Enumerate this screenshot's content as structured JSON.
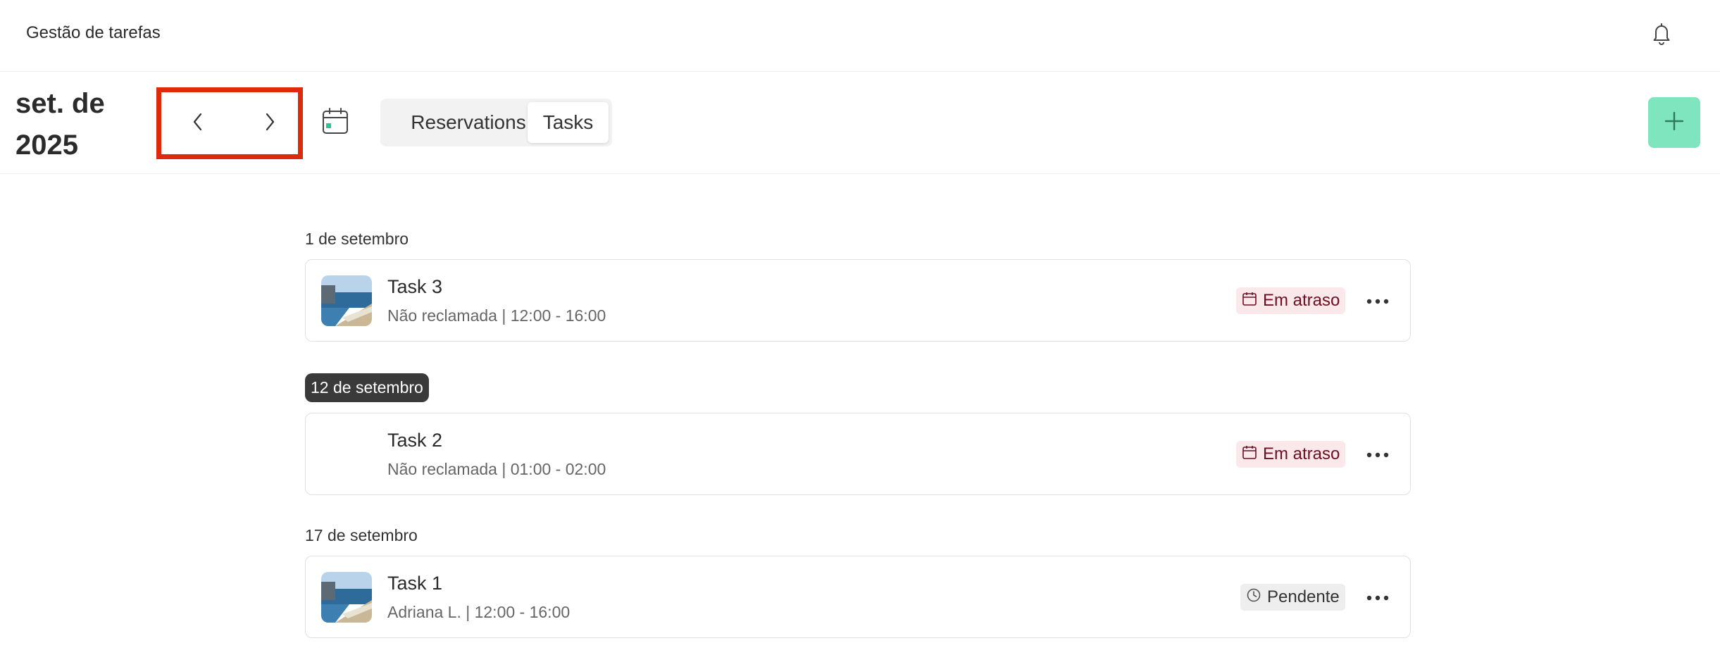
{
  "header": {
    "app_title": "Gestão de tarefas",
    "notification_icon": "bell-icon"
  },
  "toolbar": {
    "month_title": "set. de 2025",
    "prev_icon": "chevron-left-icon",
    "next_icon": "chevron-right-icon",
    "calendar_icon": "calendar-today-icon",
    "tabs": [
      {
        "label": "Reservations",
        "selected": false
      },
      {
        "label": "Tasks",
        "selected": true
      }
    ],
    "add_icon": "plus-icon"
  },
  "colors": {
    "highlight_border": "#dc2a0b",
    "add_button": "#7ee5be",
    "late_badge_bg": "#fbe8ea",
    "late_badge_text": "#6b1022",
    "pending_badge_bg": "#eeeeee",
    "today_chip_bg": "#3a3a3a"
  },
  "groups": [
    {
      "date": "1 de setembro",
      "highlighted": false,
      "tasks": [
        {
          "name": "Task 3",
          "meta": "Não reclamada | 12:00 - 16:00",
          "status": "Em atraso",
          "status_icon": "calendar-icon",
          "has_image": true
        }
      ]
    },
    {
      "date": "12 de setembro",
      "highlighted": true,
      "tasks": [
        {
          "name": "Task 2",
          "meta": "Não reclamada | 01:00 - 02:00",
          "status": "Em atraso",
          "status_icon": "calendar-icon",
          "has_image": false
        }
      ]
    },
    {
      "date": "17 de setembro",
      "highlighted": false,
      "tasks": [
        {
          "name": "Task 1",
          "meta": "Adriana L. | 12:00 - 16:00",
          "status": "Pendente",
          "status_icon": "clock-icon",
          "has_image": true
        }
      ]
    }
  ]
}
